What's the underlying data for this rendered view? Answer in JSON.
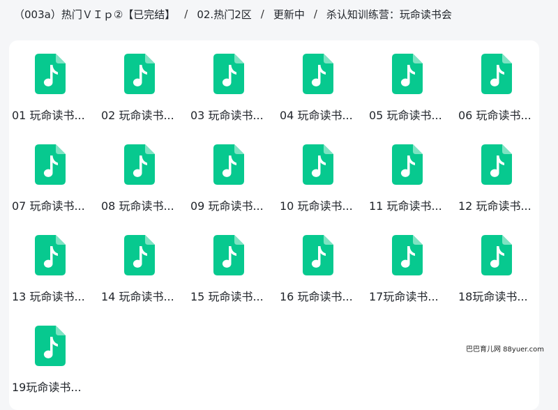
{
  "breadcrumb": {
    "items": [
      {
        "label": "（003a）热门ＶＩｐ②【已完结】"
      },
      {
        "label": "02.热门2区"
      },
      {
        "label": "更新中"
      },
      {
        "label": "杀认知训练营：玩命读书会"
      }
    ],
    "separator": "/"
  },
  "files": [
    {
      "label": "01 玩命读书..."
    },
    {
      "label": "02 玩命读书..."
    },
    {
      "label": "03 玩命读书..."
    },
    {
      "label": "04 玩命读书..."
    },
    {
      "label": "05 玩命读书..."
    },
    {
      "label": "06 玩命读书..."
    },
    {
      "label": "07 玩命读书..."
    },
    {
      "label": "08 玩命读书..."
    },
    {
      "label": "09 玩命读书..."
    },
    {
      "label": "10 玩命读书..."
    },
    {
      "label": "11 玩命读书..."
    },
    {
      "label": "12 玩命读书..."
    },
    {
      "label": "13 玩命读书..."
    },
    {
      "label": "14 玩命读书..."
    },
    {
      "label": "15 玩命读书..."
    },
    {
      "label": "16 玩命读书..."
    },
    {
      "label": "17玩命读书..."
    },
    {
      "label": "18玩命读书..."
    },
    {
      "label": "19玩命读书..."
    }
  ],
  "file_icon": {
    "name": "music-file-icon",
    "color": "#07c98f"
  },
  "watermark": "巴巴育儿网 88yuer.com"
}
